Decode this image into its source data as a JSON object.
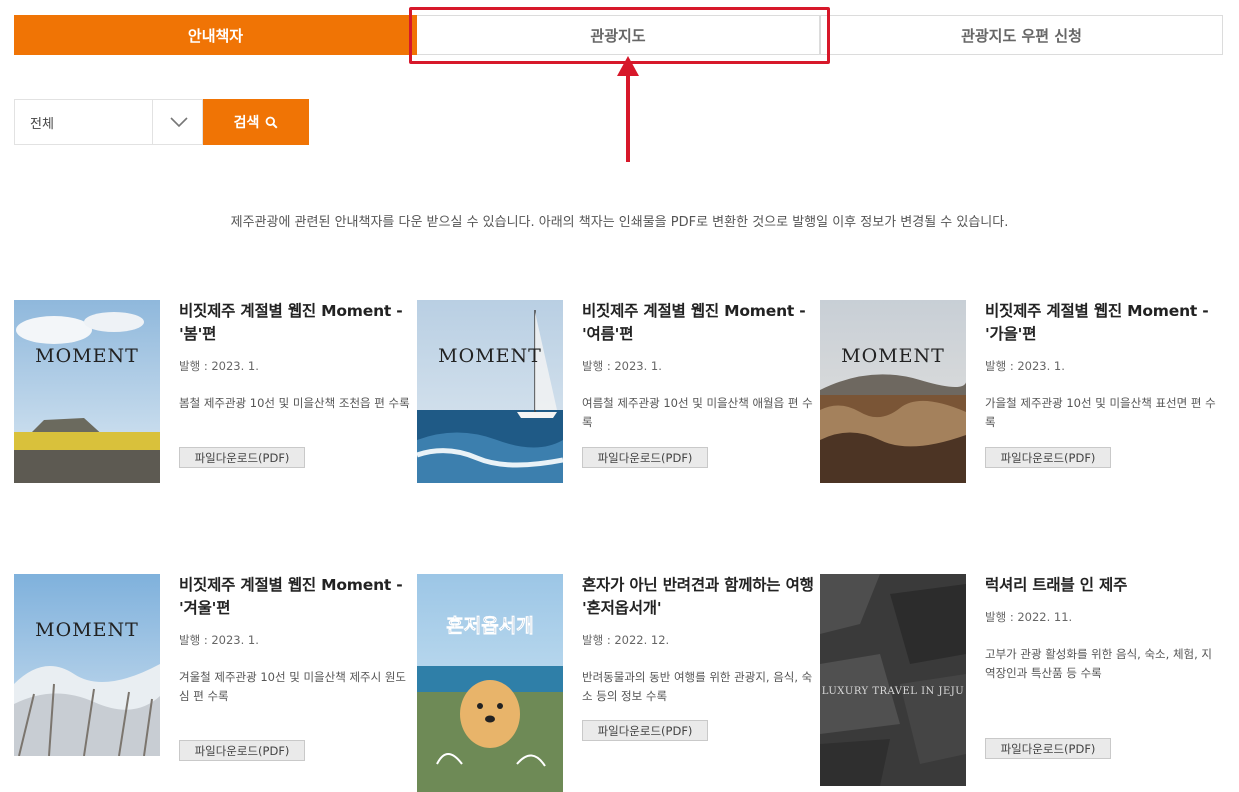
{
  "tabs": {
    "guidebook": "안내책자",
    "map": "관광지도",
    "map_mail": "관광지도 우편 신청"
  },
  "search": {
    "select_value": "전체",
    "button_label": "검색"
  },
  "intro": "제주관광에 관련된 안내책자를 다운 받으실 수 있습니다. 아래의 책자는 인쇄물을 PDF로 변환한 것으로 발행일 이후 정보가 변경될 수 있습니다.",
  "download_label": "파일다운로드(PDF)",
  "books": [
    {
      "title": "비짓제주 계절별 웹진 Moment - '봄'편",
      "date": "발행 : 2023. 1.",
      "desc": "봄철 제주관광 10선 및 미을산책 조천읍 편 수록",
      "cover_text": "MOMENT"
    },
    {
      "title": "비짓제주 계절별 웹진 Moment - '여름'편",
      "date": "발행 : 2023. 1.",
      "desc": "여름철 제주관광 10선 및 미을산책 애월읍 편 수록",
      "cover_text": "MOMENT"
    },
    {
      "title": "비짓제주 계절별 웹진 Moment - '가을'편",
      "date": "발행 : 2023. 1.",
      "desc": "가을철 제주관광 10선 및 미을산책 표선면 편 수록",
      "cover_text": "MOMENT"
    },
    {
      "title": "비짓제주 계절별 웹진 Moment - '겨울'편",
      "date": "발행 : 2023. 1.",
      "desc": "겨울철 제주관광 10선 및 미을산책 제주시 원도심 편 수록",
      "cover_text": "MOMENT"
    },
    {
      "title": "혼자가 아닌 반려견과 함께하는 여행 '혼저옵서개'",
      "date": "발행 : 2022. 12.",
      "desc": "반려동물과의 동반 여행를 위한 관광지, 음식, 숙소 등의 정보 수록",
      "cover_text": "혼저옵서개"
    },
    {
      "title": "럭셔리 트래블 인 제주",
      "date": "발행 : 2022. 11.",
      "desc": "고부가 관광 활성화를 위한 음식, 숙소, 체험, 지역장인과 특산품 등 수록",
      "cover_text": "LUXURY TRAVEL IN JEJU"
    }
  ],
  "colors": {
    "accent": "#f07405",
    "annotation": "#d7182a"
  },
  "icons": {
    "search": "search-icon",
    "dropdown": "chevron-down-icon"
  }
}
